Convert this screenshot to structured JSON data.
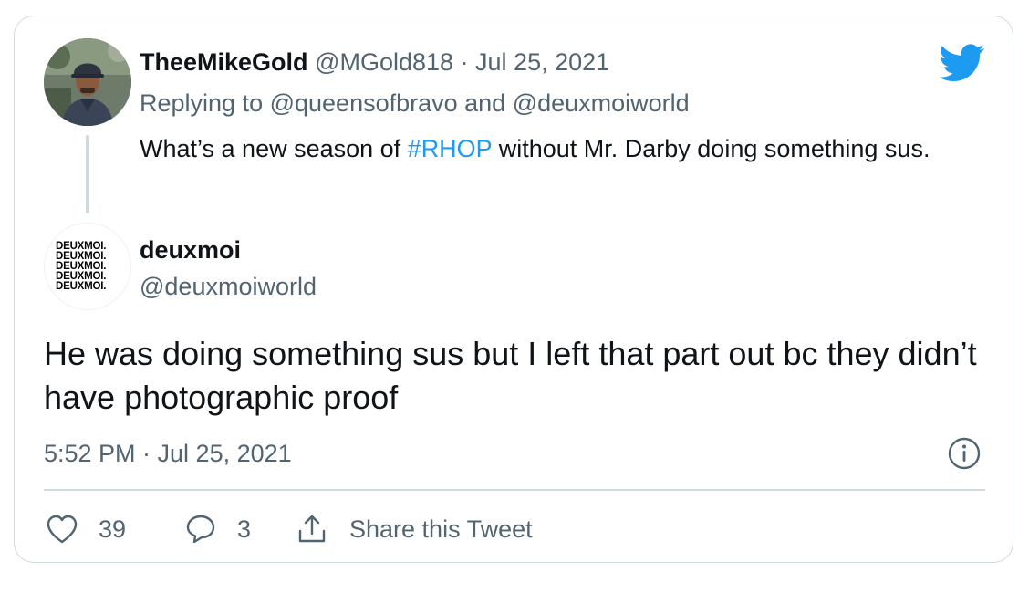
{
  "reply": {
    "name": "TheeMikeGold",
    "handle": "@MGold818",
    "separator": " · ",
    "date": "Jul 25, 2021",
    "replying_prefix": "Replying to ",
    "replying_user1": "@queensofbravo",
    "replying_and": " and ",
    "replying_user2": "@deuxmoiworld",
    "text_before": "What’s a new season of ",
    "hashtag": "#RHOP",
    "text_after": " without Mr. Darby doing something sus."
  },
  "tweet": {
    "name": "deuxmoi",
    "handle": "@deuxmoiworld",
    "avatar_logo_lines": [
      "DEUXMOI.",
      "DEUXMOI.",
      "DEUXMOI.",
      "DEUXMOI.",
      "DEUXMOI."
    ],
    "text": "He was doing something sus but I left that part out bc they didn’t have photographic proof",
    "timestamp": "5:52 PM · Jul 25, 2021"
  },
  "actions": {
    "like_count": "39",
    "reply_count": "3",
    "share_label": "Share this Tweet"
  },
  "icons": {
    "brand": "twitter-bird-icon",
    "info": "info-icon",
    "like": "heart-icon",
    "reply": "speech-bubble-icon",
    "share": "share-upload-icon"
  },
  "colors": {
    "brand_blue": "#1d9bf0",
    "text_primary": "#0f1419",
    "text_secondary": "#536471",
    "border": "#cfd9de"
  }
}
